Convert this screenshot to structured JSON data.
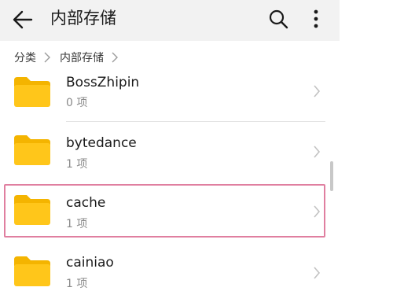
{
  "header": {
    "title": "内部存储"
  },
  "breadcrumb": {
    "items": [
      "分类",
      "内部存储"
    ]
  },
  "files": [
    {
      "name": "BossZhipin",
      "meta": "0 项"
    },
    {
      "name": "bytedance",
      "meta": "1 项"
    },
    {
      "name": "cache",
      "meta": "1 项"
    },
    {
      "name": "cainiao",
      "meta": "1 项"
    }
  ],
  "colors": {
    "folder": "#ffc61a",
    "folder_tab": "#f4b400",
    "highlight": "#e07fa0",
    "header_bg": "#f2f2f2"
  },
  "icons": {
    "back": "back-arrow-icon",
    "search": "search-icon",
    "more": "more-vertical-icon",
    "folder": "folder-icon",
    "chevron": "chevron-right-icon"
  }
}
